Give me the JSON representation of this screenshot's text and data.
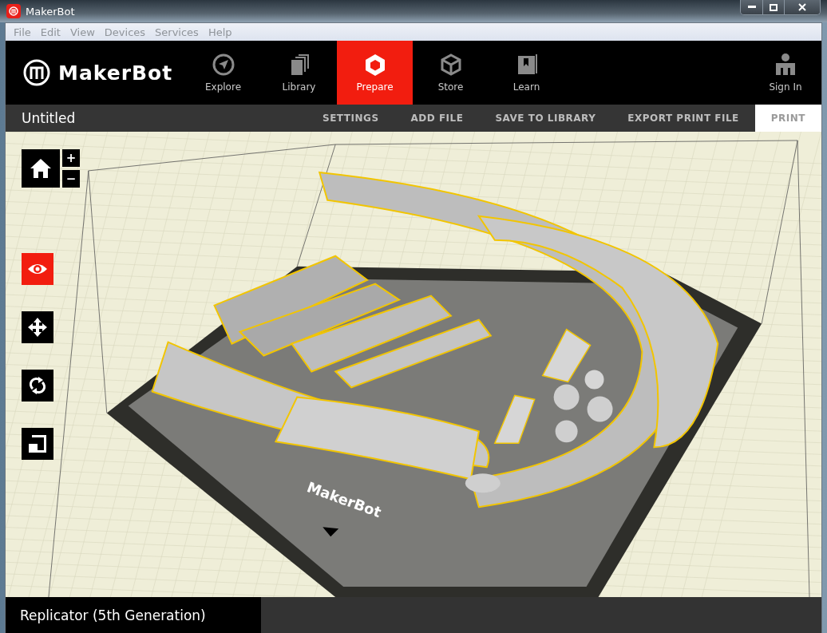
{
  "window": {
    "title": "MakerBot"
  },
  "menu": [
    "File",
    "Edit",
    "View",
    "Devices",
    "Services",
    "Help"
  ],
  "brand": "MakerBot",
  "nav": [
    {
      "label": "Explore",
      "kind": "explore",
      "selected": false
    },
    {
      "label": "Library",
      "kind": "library",
      "selected": false
    },
    {
      "label": "Prepare",
      "kind": "prepare",
      "selected": true
    },
    {
      "label": "Store",
      "kind": "store",
      "selected": false
    },
    {
      "label": "Learn",
      "kind": "learn",
      "selected": false
    }
  ],
  "sign_in": "Sign In",
  "document_title": "Untitled",
  "actions": [
    {
      "label": "SETTINGS",
      "disabled": false,
      "kind": "link"
    },
    {
      "label": "ADD FILE",
      "disabled": false,
      "kind": "link"
    },
    {
      "label": "SAVE TO LIBRARY",
      "disabled": false,
      "kind": "link"
    },
    {
      "label": "EXPORT PRINT FILE",
      "disabled": false,
      "kind": "link"
    },
    {
      "label": "PRINT",
      "disabled": true,
      "kind": "primary"
    }
  ],
  "zoom": {
    "in": "+",
    "out": "−"
  },
  "tools": [
    {
      "kind": "view",
      "selected": true
    },
    {
      "kind": "move",
      "selected": false
    },
    {
      "kind": "rotate",
      "selected": false
    },
    {
      "kind": "scale",
      "selected": false
    }
  ],
  "plate_label": "MakerBot",
  "printer": "Replicator (5th Generation)"
}
